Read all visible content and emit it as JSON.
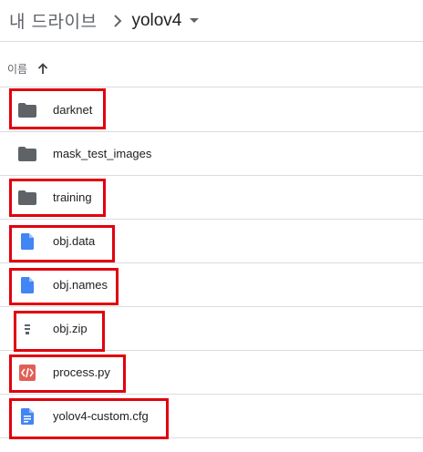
{
  "breadcrumb": {
    "root": "내 드라이브",
    "current": "yolov4"
  },
  "column_header": {
    "name_label": "이름"
  },
  "files": [
    {
      "name": "darknet",
      "type": "folder",
      "highlighted": true
    },
    {
      "name": "mask_test_images",
      "type": "folder",
      "highlighted": false
    },
    {
      "name": "training",
      "type": "folder",
      "highlighted": true
    },
    {
      "name": "obj.data",
      "type": "file",
      "highlighted": true
    },
    {
      "name": "obj.names",
      "type": "file",
      "highlighted": true
    },
    {
      "name": "obj.zip",
      "type": "archive",
      "highlighted": true
    },
    {
      "name": "process.py",
      "type": "code",
      "highlighted": true
    },
    {
      "name": "yolov4-custom.cfg",
      "type": "doc",
      "highlighted": true
    }
  ],
  "colors": {
    "folder": "#5f6368",
    "file": "#4285f4",
    "code": "#e06055",
    "highlight": "#e1000e"
  }
}
